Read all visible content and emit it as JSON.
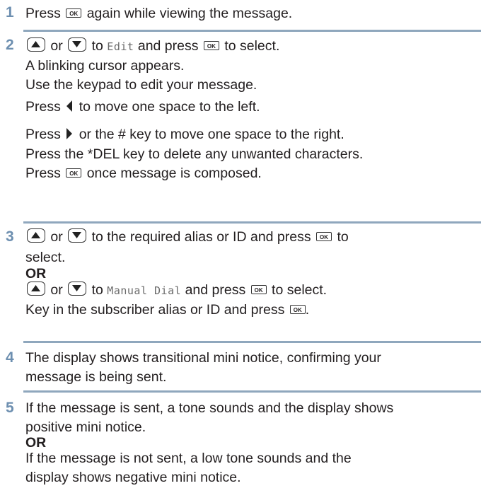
{
  "steps": [
    {
      "number": "1",
      "lines": {
        "l1": {
          "a": "Press",
          "b": "again while viewing the message."
        }
      }
    },
    {
      "number": "2",
      "l1": {
        "a": "or",
        "b": "to",
        "menu": "Edit",
        "c": "and press",
        "d": "to select."
      },
      "l2": "A blinking cursor appears.",
      "l3": "Use the keypad to edit your message.",
      "l4": {
        "a": "Press",
        "b": "to move one space to the left."
      },
      "l5": {
        "a": "Press",
        "b": "or the # key to move one space to the right."
      },
      "l6": "Press the *DEL key to delete any unwanted characters.",
      "l7": {
        "a": "Press",
        "b": "once message is composed."
      }
    },
    {
      "number": "3",
      "l1": {
        "a": "or",
        "b": "to the required alias or ID and press",
        "c": "to"
      },
      "l2": "select.",
      "or": "OR",
      "l3": {
        "a": "or",
        "b": "to",
        "menu": "Manual Dial",
        "c": "and press",
        "d": "to select."
      },
      "l4": {
        "a": "Key in the subscriber alias or ID and press",
        "b": "."
      }
    },
    {
      "number": "4",
      "l1": "The display shows transitional mini notice, confirming your",
      "l2": "message is being sent."
    },
    {
      "number": "5",
      "l1": "If the message is sent, a tone sounds and the display shows",
      "l2": "positive mini notice.",
      "or": "OR",
      "l3": "If the message is not sent, a low tone sounds and the",
      "l4": "display shows negative mini notice."
    }
  ],
  "icons": {
    "ok_key_label": "OK"
  },
  "colors": {
    "step_number": "#6d8fb0",
    "rule": "#8fa7bd",
    "text": "#231f20"
  }
}
